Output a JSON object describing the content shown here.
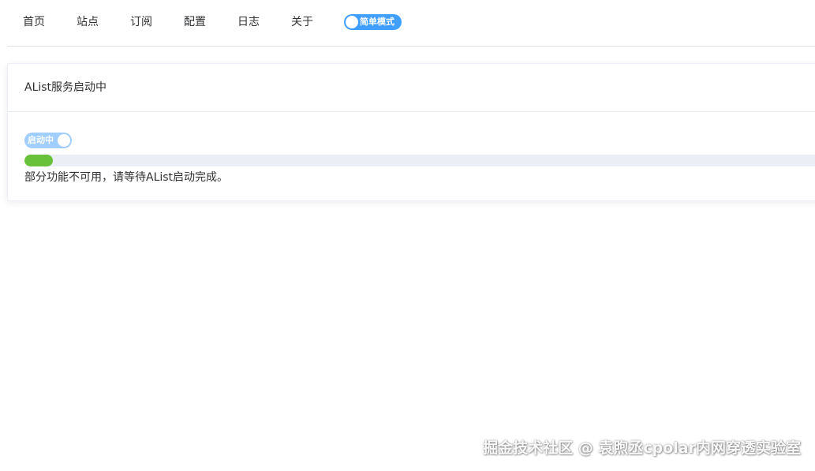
{
  "nav": {
    "items": [
      {
        "label": "首页"
      },
      {
        "label": "站点"
      },
      {
        "label": "订阅"
      },
      {
        "label": "配置"
      },
      {
        "label": "日志"
      },
      {
        "label": "关于"
      }
    ],
    "mode_toggle": {
      "label": "简单模式",
      "on": true
    }
  },
  "card": {
    "title": "AList服务启动中",
    "status_toggle": {
      "label": "启动中",
      "on": true
    },
    "progress": {
      "value_percent": 3.5
    },
    "message": "部分功能不可用，请等待AList启动完成。"
  },
  "watermark": "掘金技术社区 @ 袁煦丞cpolar内网穿透实验室",
  "colors": {
    "accent": "#409eff",
    "toggle_light": "#a0cfff",
    "progress_fill": "#67c23a",
    "progress_track": "#ebeef5"
  }
}
